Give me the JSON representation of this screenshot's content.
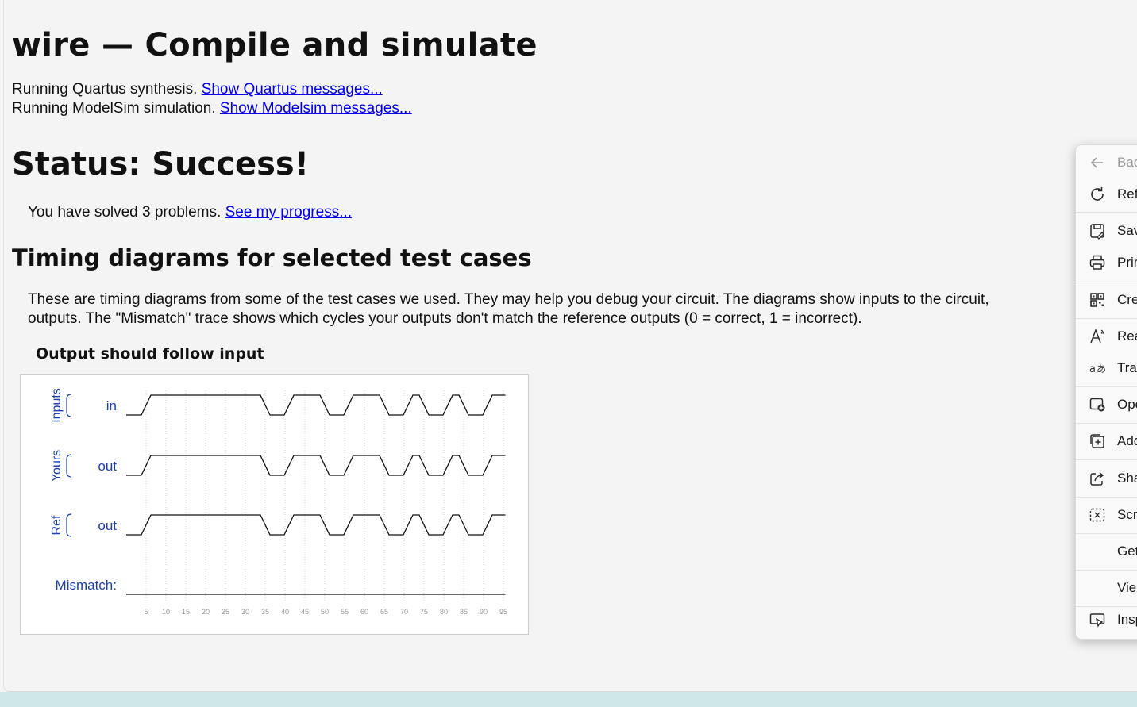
{
  "header": {
    "title": "wire — Compile and simulate"
  },
  "messages": {
    "quartus_text": "Running Quartus synthesis.",
    "quartus_link": "Show Quartus messages...",
    "modelsim_text": "Running ModelSim simulation.",
    "modelsim_link": "Show Modelsim messages..."
  },
  "status": {
    "heading": "Status: Success!",
    "solved_text": "You have solved 3 problems.",
    "progress_link": "See my progress..."
  },
  "timing": {
    "heading": "Timing diagrams for selected test cases",
    "description_line1": "These are timing diagrams from some of the test cases we used. They may help you debug your circuit. The diagrams show inputs to the circuit,",
    "description_line2": "outputs. The \"Mismatch\" trace shows which cycles your outputs don't match the reference outputs (0 = correct, 1 = incorrect).",
    "diagram_title": "Output should follow input",
    "groups": [
      {
        "label": "Inputs",
        "signal": "in"
      },
      {
        "label": "Yours",
        "signal": "out"
      },
      {
        "label": "Ref",
        "signal": "out"
      }
    ],
    "mismatch_label": "Mismatch:",
    "ticks": [
      "5",
      "10",
      "15",
      "20",
      "25",
      "30",
      "35",
      "40",
      "45",
      "50",
      "55",
      "60",
      "65",
      "70",
      "75",
      "80",
      "85",
      "90",
      "95"
    ],
    "waveform_high_intervals": [
      [
        5,
        35
      ],
      [
        41,
        50
      ],
      [
        56,
        65
      ],
      [
        71,
        75
      ],
      [
        81,
        85
      ],
      [
        91,
        95
      ]
    ],
    "label_color": "#1a3fb0"
  },
  "context_menu": {
    "items": [
      {
        "label": "Bac",
        "icon": "back-arrow-icon",
        "disabled": true
      },
      {
        "label": "Ref",
        "icon": "refresh-icon"
      },
      {
        "label": "Sav",
        "icon": "save-icon"
      },
      {
        "label": "Prir",
        "icon": "print-icon"
      },
      {
        "label": "Cre",
        "icon": "qr-code-icon"
      },
      {
        "label": "Rea",
        "icon": "read-aloud-icon"
      },
      {
        "label": "Trar",
        "icon": "translate-icon"
      },
      {
        "label": "Ope",
        "icon": "open-window-icon"
      },
      {
        "label": "Add",
        "icon": "add-collection-icon"
      },
      {
        "label": "Sha",
        "icon": "share-icon"
      },
      {
        "label": "Scre",
        "icon": "screenshot-icon"
      },
      {
        "label": "Get",
        "icon": ""
      },
      {
        "label": "Vie",
        "icon": ""
      },
      {
        "label": "Insp",
        "icon": "inspect-icon"
      }
    ]
  }
}
